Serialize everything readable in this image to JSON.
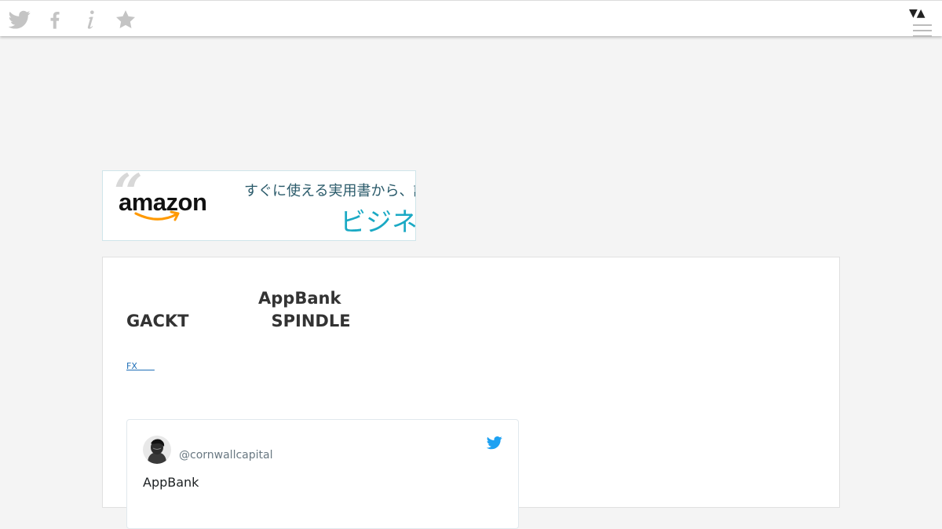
{
  "topbar": {
    "share_icons": [
      "twitter-icon",
      "facebook-icon",
      "info-icon",
      "star-icon"
    ],
    "toggle_label": "▼▲",
    "icon_color": "#c4c4c4"
  },
  "ad": {
    "logo_text": "amazon",
    "tagline": "すぐに使える実用書から、話",
    "headline": "ビジネス",
    "accent_color": "#1aa9c4"
  },
  "article": {
    "title": "　　　　　　　　AppBank　GACKT　　　　　SPINDLE　　　　　　　　",
    "tag": "FX　　"
  },
  "tweet": {
    "handle": "@cornwallcapital",
    "text": "AppBank",
    "brand_color": "#1da1f2"
  }
}
